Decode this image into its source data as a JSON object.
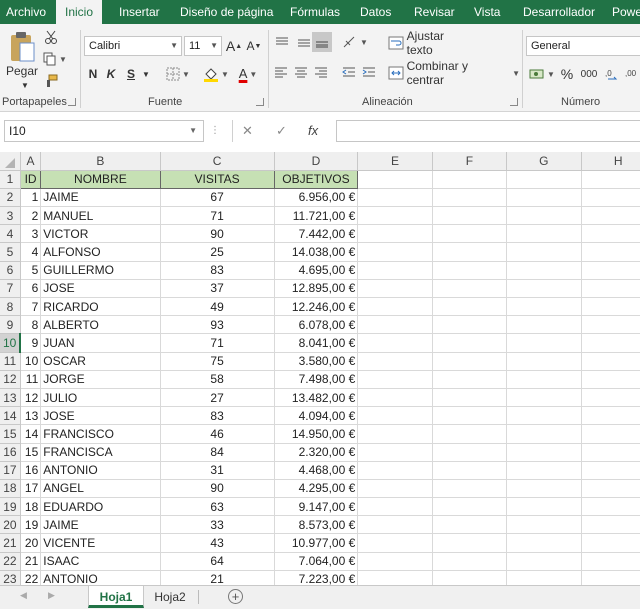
{
  "menu": {
    "tabs": [
      "Archivo",
      "Inicio",
      "Insertar",
      "Diseño de página",
      "Fórmulas",
      "Datos",
      "Revisar",
      "Vista",
      "Desarrollador",
      "Power"
    ],
    "active": "Inicio"
  },
  "ribbon": {
    "clipboard": {
      "paste_label": "Pegar",
      "group_label": "Portapapeles"
    },
    "font": {
      "name": "Calibri",
      "size": "11",
      "bold": "N",
      "italic": "K",
      "underline": "S",
      "grow": "A",
      "shrink": "A",
      "font_color_glyph": "A",
      "group_label": "Fuente"
    },
    "alignment": {
      "wrap_text": "Ajustar texto",
      "merge_center": "Combinar y centrar",
      "group_label": "Alineación"
    },
    "number": {
      "format": "General",
      "percent": "%",
      "thousands": "000",
      "group_label": "Número"
    },
    "colors": {
      "fill_highlight": "#ffd800",
      "font_red": "#e00000"
    }
  },
  "formula_bar": {
    "name_box": "I10",
    "cancel": "✕",
    "enter": "✓",
    "fx": "fx",
    "value": ""
  },
  "grid": {
    "columns": [
      "A",
      "B",
      "C",
      "D",
      "E",
      "F",
      "G",
      "H"
    ],
    "headers": [
      "ID",
      "NOMBRE",
      "VISITAS",
      "OBJETIVOS"
    ],
    "selected_row": 10,
    "rows": [
      {
        "id": "1",
        "nombre": "JAIME",
        "visitas": "67",
        "objetivos": "6.956,00 €"
      },
      {
        "id": "2",
        "nombre": "MANUEL",
        "visitas": "71",
        "objetivos": "11.721,00 €"
      },
      {
        "id": "3",
        "nombre": "VICTOR",
        "visitas": "90",
        "objetivos": "7.442,00 €"
      },
      {
        "id": "4",
        "nombre": "ALFONSO",
        "visitas": "25",
        "objetivos": "14.038,00 €"
      },
      {
        "id": "5",
        "nombre": "GUILLERMO",
        "visitas": "83",
        "objetivos": "4.695,00 €"
      },
      {
        "id": "6",
        "nombre": "JOSE",
        "visitas": "37",
        "objetivos": "12.895,00 €"
      },
      {
        "id": "7",
        "nombre": "RICARDO",
        "visitas": "49",
        "objetivos": "12.246,00 €"
      },
      {
        "id": "8",
        "nombre": "ALBERTO",
        "visitas": "93",
        "objetivos": "6.078,00 €"
      },
      {
        "id": "9",
        "nombre": "JUAN",
        "visitas": "71",
        "objetivos": "8.041,00 €"
      },
      {
        "id": "10",
        "nombre": "OSCAR",
        "visitas": "75",
        "objetivos": "3.580,00 €"
      },
      {
        "id": "11",
        "nombre": "JORGE",
        "visitas": "58",
        "objetivos": "7.498,00 €"
      },
      {
        "id": "12",
        "nombre": "JULIO",
        "visitas": "27",
        "objetivos": "13.482,00 €"
      },
      {
        "id": "13",
        "nombre": "JOSE",
        "visitas": "83",
        "objetivos": "4.094,00 €"
      },
      {
        "id": "14",
        "nombre": "FRANCISCO",
        "visitas": "46",
        "objetivos": "14.950,00 €"
      },
      {
        "id": "15",
        "nombre": "FRANCISCA",
        "visitas": "84",
        "objetivos": "2.320,00 €"
      },
      {
        "id": "16",
        "nombre": "ANTONIO",
        "visitas": "31",
        "objetivos": "4.468,00 €"
      },
      {
        "id": "17",
        "nombre": "ANGEL",
        "visitas": "90",
        "objetivos": "4.295,00 €"
      },
      {
        "id": "18",
        "nombre": "EDUARDO",
        "visitas": "63",
        "objetivos": "9.147,00 €"
      },
      {
        "id": "19",
        "nombre": "JAIME",
        "visitas": "33",
        "objetivos": "8.573,00 €"
      },
      {
        "id": "20",
        "nombre": "VICENTE",
        "visitas": "43",
        "objetivos": "10.977,00 €"
      },
      {
        "id": "21",
        "nombre": "ISAAC",
        "visitas": "64",
        "objetivos": "7.064,00 €"
      },
      {
        "id": "22",
        "nombre": "ANTONIO",
        "visitas": "21",
        "objetivos": "7.223,00 €"
      }
    ]
  },
  "sheets": {
    "tabs": [
      "Hoja1",
      "Hoja2"
    ],
    "active": "Hoja1",
    "add": "+"
  }
}
